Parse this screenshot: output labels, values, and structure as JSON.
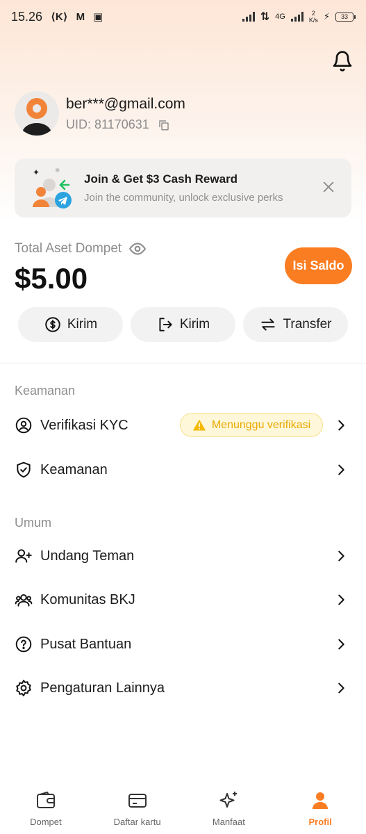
{
  "status_bar": {
    "time": "15.26",
    "network": "4G",
    "speed_value": "2",
    "speed_unit": "K/s",
    "battery": "33"
  },
  "profile": {
    "email": "ber***@gmail.com",
    "uid": "UID: 81170631"
  },
  "banner": {
    "title": "Join & Get $3 Cash Reward",
    "subtitle": "Join the community, unlock exclusive perks"
  },
  "wallet": {
    "label": "Total Aset Dompet",
    "balance": "$5.00",
    "topup_label": "Isi Saldo",
    "actions": [
      {
        "label": "Kirim",
        "icon": "dollar-exchange-icon"
      },
      {
        "label": "Kirim",
        "icon": "send-out-icon"
      },
      {
        "label": "Transfer",
        "icon": "transfer-arrows-icon"
      }
    ]
  },
  "sections": {
    "security_title": "Keamanan",
    "general_title": "Umum"
  },
  "menu": {
    "kyc": {
      "label": "Verifikasi KYC",
      "badge": "Menunggu verifikasi",
      "icon": "user-circle-icon"
    },
    "security": {
      "label": "Keamanan",
      "icon": "shield-check-icon"
    },
    "invite": {
      "label": "Undang Teman",
      "icon": "user-plus-icon"
    },
    "community": {
      "label": "Komunitas BKJ",
      "icon": "users-icon"
    },
    "help": {
      "label": "Pusat Bantuan",
      "icon": "question-circle-icon"
    },
    "settings": {
      "label": "Pengaturan Lainnya",
      "icon": "gear-icon"
    }
  },
  "bottom_nav": [
    {
      "label": "Dompet",
      "icon": "wallet-icon",
      "active": false
    },
    {
      "label": "Daftar kartu",
      "icon": "card-icon",
      "active": false
    },
    {
      "label": "Manfaat",
      "icon": "sparkle-icon",
      "active": false
    },
    {
      "label": "Profil",
      "icon": "person-icon",
      "active": true
    }
  ],
  "colors": {
    "accent": "#fb7d22",
    "badge_bg": "#fff7d9",
    "badge_text": "#e7a900",
    "pill_bg": "#f2f2f2"
  }
}
